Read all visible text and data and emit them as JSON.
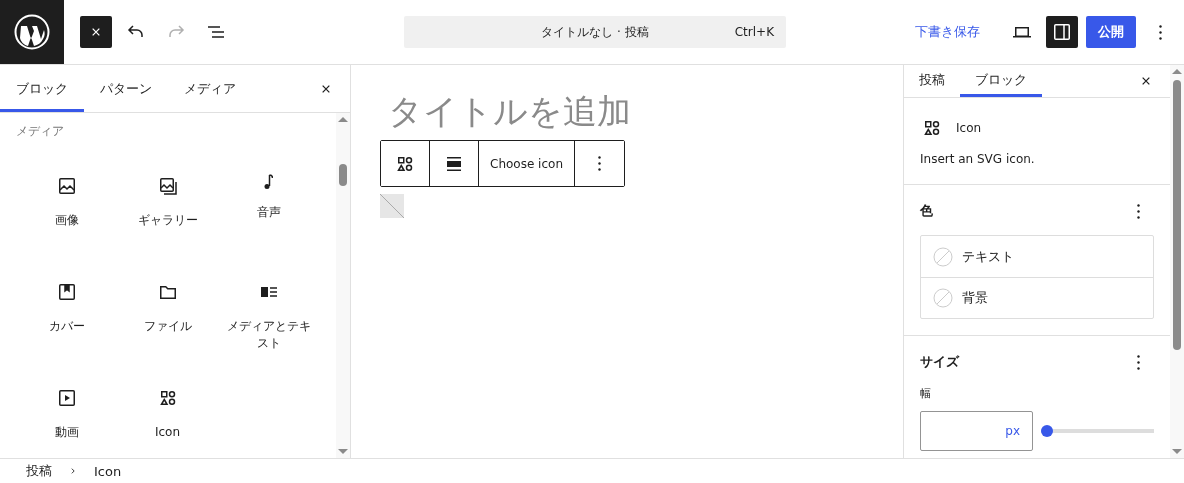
{
  "header": {
    "undo": {
      "disabled": false
    },
    "redo": {
      "disabled": true
    },
    "command_bar": {
      "title": "タイトルなし · 投稿",
      "shortcut": "Ctrl+K"
    },
    "save_draft": "下書き保存",
    "settings_toggle": {
      "pressed": true
    },
    "publish": "公開"
  },
  "inserter": {
    "tabs": [
      {
        "label": "ブロック",
        "selected": true
      },
      {
        "label": "パターン",
        "selected": false
      },
      {
        "label": "メディア",
        "selected": false
      }
    ],
    "category": "メディア",
    "blocks": [
      {
        "label": "画像",
        "kind": "image"
      },
      {
        "label": "ギャラリー",
        "kind": "gallery"
      },
      {
        "label": "音声",
        "kind": "audio"
      },
      {
        "label": "カバー",
        "kind": "cover"
      },
      {
        "label": "ファイル",
        "kind": "file"
      },
      {
        "label": "メディアとテキスト",
        "kind": "media"
      },
      {
        "label": "動画",
        "kind": "video"
      },
      {
        "label": "Icon",
        "kind": "icon"
      }
    ]
  },
  "editor": {
    "title_placeholder": "タイトルを追加",
    "block_toolbar": {
      "label": "Choose icon"
    }
  },
  "sidebar": {
    "tabs": [
      {
        "label": "投稿",
        "selected": false
      },
      {
        "label": "ブロック",
        "selected": true
      }
    ],
    "block": {
      "name": "Icon",
      "description": "Insert an SVG icon."
    },
    "color": {
      "title": "色",
      "items": [
        {
          "label": "テキスト"
        },
        {
          "label": "背景"
        }
      ]
    },
    "size": {
      "title": "サイズ",
      "width_label": "幅",
      "unit": "px",
      "level": 0
    }
  },
  "breadcrumb": [
    {
      "label": "投稿"
    },
    {
      "label": "Icon"
    }
  ]
}
